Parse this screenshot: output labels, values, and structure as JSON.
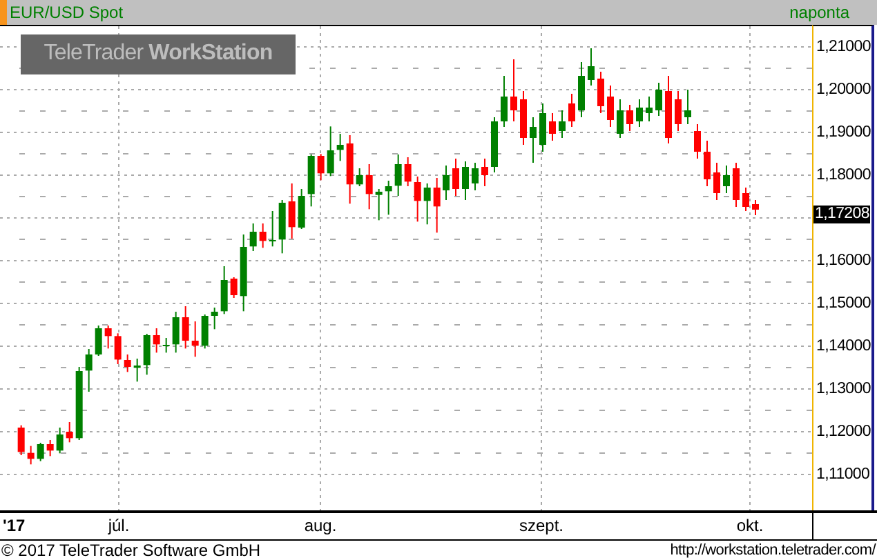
{
  "header": {
    "symbol": "EUR/USD Spot",
    "interval": "naponta"
  },
  "logo": {
    "light": "TeleTrader",
    "bold": "WorkStation"
  },
  "y_axis": {
    "ticks_above": [
      "1,21000",
      "1,20000",
      "1,19000",
      "1,18000"
    ],
    "last_price": "1,17208",
    "ticks_below": [
      "1,16000",
      "1,15000",
      "1,14000",
      "1,13000",
      "1,12000",
      "1,11000"
    ]
  },
  "x_axis": {
    "year": "'17",
    "months": [
      "júl.",
      "aug.",
      "szept.",
      "okt."
    ]
  },
  "footer": {
    "copyright": "© 2017 TeleTrader Software GmbH",
    "url": "http://workstation.teletrader.com/"
  }
}
